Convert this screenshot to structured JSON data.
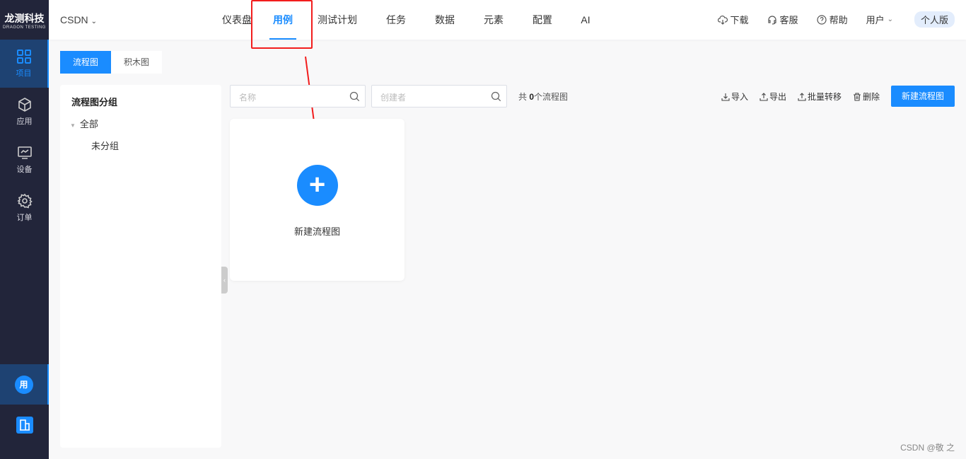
{
  "sidebar": {
    "logo_title": "龙测科技",
    "logo_sub": "DRAGON TESTING",
    "items": [
      {
        "label": "项目",
        "icon": "grid-icon"
      },
      {
        "label": "应用",
        "icon": "cube-icon"
      },
      {
        "label": "设备",
        "icon": "monitor-icon"
      },
      {
        "label": "订单",
        "icon": "gear-icon"
      }
    ],
    "user_avatar": "用",
    "org_icon": "building-icon"
  },
  "header": {
    "project": "CSDN",
    "nav": [
      "仪表盘",
      "用例",
      "测试计划",
      "任务",
      "数据",
      "元素",
      "配置",
      "AI"
    ],
    "active_nav": "用例",
    "download": "下载",
    "service": "客服",
    "help": "帮助",
    "user": "用户",
    "edition": "个人版"
  },
  "tabs": [
    "流程图",
    "积木图"
  ],
  "groups": {
    "title": "流程图分组",
    "all": "全部",
    "ungrouped": "未分组"
  },
  "filters": {
    "name_placeholder": "名称",
    "creator_placeholder": "创建者",
    "count_prefix": "共 ",
    "count": "0",
    "count_suffix": "个流程图"
  },
  "actions": {
    "import": "导入",
    "export": "导出",
    "batch_move": "批量转移",
    "delete": "删除",
    "new": "新建流程图"
  },
  "card": {
    "label": "新建流程图"
  },
  "watermark": "CSDN @敬 之",
  "colors": {
    "accent": "#1a8cff",
    "sidebar": "#22253a",
    "annotation": "#f21d1d"
  }
}
